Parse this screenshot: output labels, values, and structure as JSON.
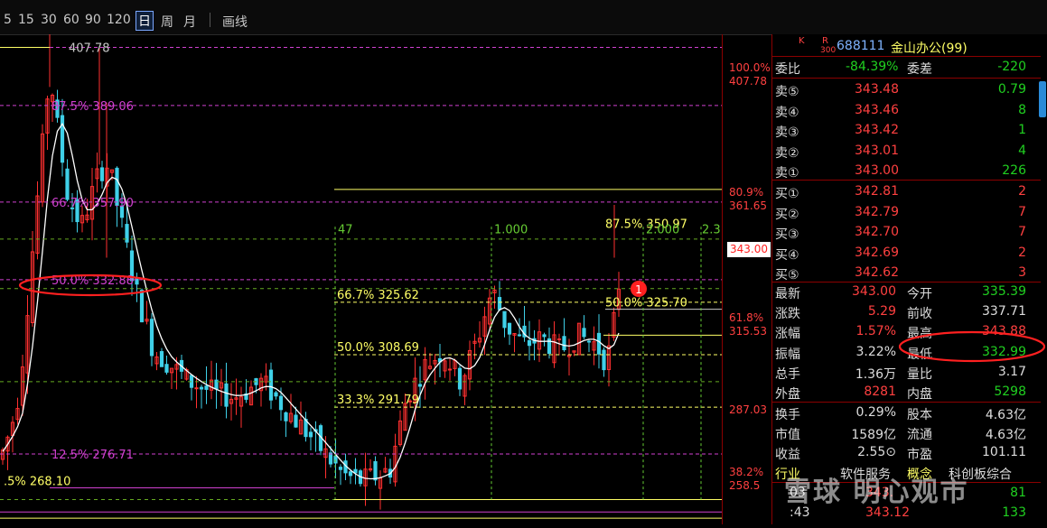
{
  "toolbar": {
    "periods": [
      "5",
      "15",
      "30",
      "60",
      "90",
      "120",
      "日",
      "周",
      "月"
    ],
    "selected": "日",
    "draw_label": "画线"
  },
  "chart_data": {
    "type": "candlestick",
    "fib_levels_left": [
      {
        "text": "407.78",
        "price": 407.78
      },
      {
        "text": "87.5% 389.06",
        "price": 389.06
      },
      {
        "text": "66.7% 357.90",
        "price": 357.9
      },
      {
        "text": "50.0% 332.88",
        "price": 332.88
      },
      {
        "text": "12.5% 276.71",
        "price": 276.71
      },
      {
        "text": ".5% 268.10",
        "price": 268.1
      }
    ],
    "fib_levels_mid": [
      {
        "text": "66.7% 325.62",
        "price": 325.62
      },
      {
        "text": "50.0% 308.69",
        "price": 308.69
      },
      {
        "text": "33.3% 291.79",
        "price": 291.79
      }
    ],
    "fib_levels_right": [
      {
        "text": "87.5% 350.97",
        "price": 350.97
      },
      {
        "text": "50.0% 325.70",
        "price": 325.7
      }
    ],
    "time_labels": [
      "47",
      "1.000",
      "2.000",
      "2.3"
    ],
    "marker": "1",
    "price_ylim": [
      254,
      412
    ]
  },
  "scale": {
    "pct_labels": [
      "100.0%",
      "80.9%",
      "61.8%",
      "38.2%"
    ],
    "price_labels": [
      "407.78",
      "361.65",
      "315.53",
      "287.03",
      "258.5"
    ],
    "current": "343.00"
  },
  "quote": {
    "header": {
      "code": "688111",
      "name": "金山办公(99)",
      "k": "K",
      "r": "R",
      "r_sub": "300"
    },
    "weibi": {
      "label": "委比",
      "value": "-84.39%",
      "label2": "委差",
      "value2": "-220"
    },
    "sells": [
      {
        "label": "卖⑤",
        "price": "343.48",
        "vol": "0.79"
      },
      {
        "label": "卖④",
        "price": "343.46",
        "vol": "8"
      },
      {
        "label": "卖③",
        "price": "343.42",
        "vol": "1"
      },
      {
        "label": "卖②",
        "price": "343.01",
        "vol": "4"
      },
      {
        "label": "卖①",
        "price": "343.00",
        "vol": "226"
      }
    ],
    "buys": [
      {
        "label": "买①",
        "price": "342.81",
        "vol": "2"
      },
      {
        "label": "买②",
        "price": "342.79",
        "vol": "7"
      },
      {
        "label": "买③",
        "price": "342.70",
        "vol": "7"
      },
      {
        "label": "买④",
        "price": "342.69",
        "vol": "2"
      },
      {
        "label": "买⑤",
        "price": "342.62",
        "vol": "3"
      }
    ],
    "stats": [
      {
        "l1": "最新",
        "v1": "343.00",
        "l2": "今开",
        "v2": "335.39",
        "c1": "red",
        "c2": "green"
      },
      {
        "l1": "涨跌",
        "v1": "5.29",
        "l2": "前收",
        "v2": "337.71",
        "c1": "red",
        "c2": "white"
      },
      {
        "l1": "涨幅",
        "v1": "1.57%",
        "l2": "最高",
        "v2": "343.88",
        "c1": "red",
        "c2": "red"
      },
      {
        "l1": "振幅",
        "v1": "3.22%",
        "l2": "最低",
        "v2": "332.99",
        "c1": "white",
        "c2": "green"
      },
      {
        "l1": "总手",
        "v1": "1.36万",
        "l2": "量比",
        "v2": "3.17",
        "c1": "white",
        "c2": "white"
      },
      {
        "l1": "外盘",
        "v1": "8281",
        "l2": "内盘",
        "v2": "5298",
        "c1": "red",
        "c2": "green"
      }
    ],
    "stats2": [
      {
        "l1": "换手",
        "v1": "0.29%",
        "l2": "股本",
        "v2": "4.63亿"
      },
      {
        "l1": "市值",
        "v1": "1589亿",
        "l2": "流通",
        "v2": "4.63亿"
      },
      {
        "l1": "收益",
        "v1": "2.55⊙",
        "l2": "市盈",
        "v2": "101.11"
      }
    ],
    "industry": {
      "label": "行业",
      "value": "软件服务",
      "label2": "概念",
      "value2": "科创板综合"
    },
    "ticks": [
      {
        "time": "03",
        "price": "343.",
        "vol": "81"
      },
      {
        "time": ":43",
        "price": "343.12",
        "vol": "133"
      }
    ]
  },
  "watermark": "雪球 明心观市"
}
